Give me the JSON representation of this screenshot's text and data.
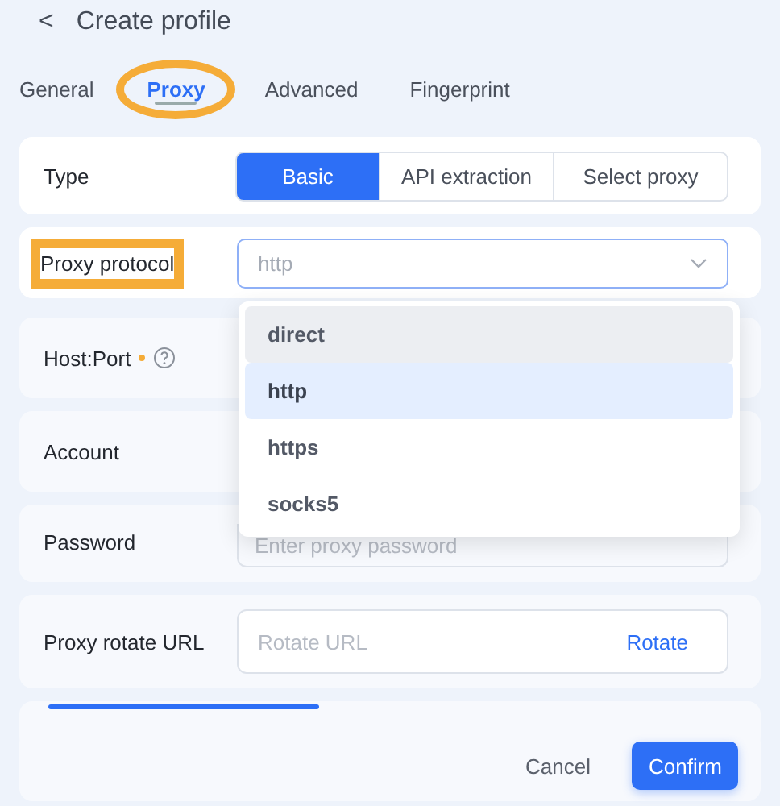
{
  "header": {
    "back": "<",
    "title": "Create profile"
  },
  "tabs": [
    {
      "label": "General",
      "selected": false,
      "annotated": false
    },
    {
      "label": "Proxy",
      "selected": true,
      "annotated": true
    },
    {
      "label": "Advanced",
      "selected": false,
      "annotated": false
    },
    {
      "label": "Fingerprint",
      "selected": false,
      "annotated": false
    }
  ],
  "type_row": {
    "label": "Type",
    "options": [
      {
        "label": "Basic",
        "selected": true
      },
      {
        "label": "API extraction",
        "selected": false
      },
      {
        "label": "Select proxy",
        "selected": false
      }
    ]
  },
  "protocol_row": {
    "label": "Proxy protocol",
    "annotated": true,
    "value": "http",
    "expanded": true,
    "options": [
      {
        "label": "direct",
        "selected": false,
        "hovered": true
      },
      {
        "label": "http",
        "selected": true,
        "hovered": false
      },
      {
        "label": "https",
        "selected": false,
        "hovered": false
      },
      {
        "label": "socks5",
        "selected": false,
        "hovered": false
      }
    ]
  },
  "host_row": {
    "label": "Host:Port",
    "required": true
  },
  "account_row": {
    "label": "Account"
  },
  "password_row": {
    "label": "Password",
    "placeholder": "Enter proxy password"
  },
  "rotate_row": {
    "label": "Proxy rotate URL",
    "placeholder": "Rotate URL",
    "action": "Rotate"
  },
  "footer": {
    "cancel": "Cancel",
    "confirm": "Confirm"
  }
}
